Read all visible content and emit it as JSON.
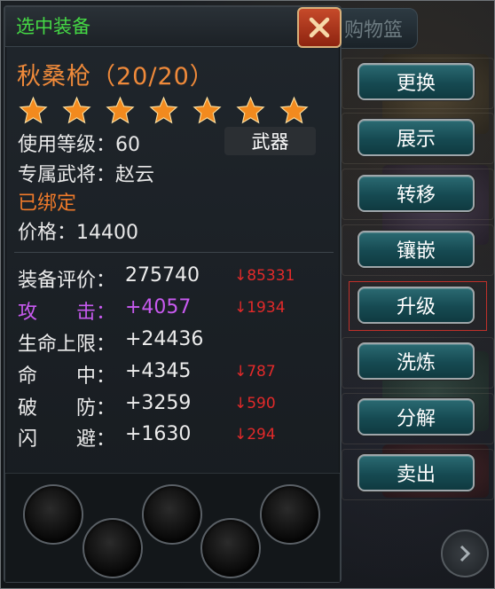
{
  "panel": {
    "title": "选中装备",
    "item_name": "秋桑枪（20/20）",
    "star_count": 7,
    "star_color": "#f28a1e",
    "level_line": "使用等级：60",
    "type_badge": "武器",
    "exclusive_line": "专属武将：赵云",
    "bound_text": "已绑定",
    "price_line": "价格：14400"
  },
  "stats": [
    {
      "label": "装备评价：",
      "value": "275740",
      "diff": "↓85331",
      "highlight": false
    },
    {
      "label": "攻　　击：",
      "value": "+4057",
      "diff": "↓1934",
      "highlight": true
    },
    {
      "label": "生命上限：",
      "value": "+24436",
      "diff": "",
      "highlight": false
    },
    {
      "label": "命　　中：",
      "value": "+4345",
      "diff": "↓787",
      "highlight": false
    },
    {
      "label": "破　　防：",
      "value": "+3259",
      "diff": "↓590",
      "highlight": false
    },
    {
      "label": "闪　　避：",
      "value": "+1630",
      "diff": "↓294",
      "highlight": false
    }
  ],
  "sockets_count": 5,
  "background": {
    "basket_tab": "购物篮"
  },
  "actions": [
    "更换",
    "展示",
    "转移",
    "镶嵌",
    "升级",
    "洗炼",
    "分解",
    "卖出"
  ],
  "highlighted_action": "升级",
  "icons": {
    "close": "close-x-icon",
    "star": "star-icon",
    "next": "chevron-right-icon"
  },
  "colors": {
    "title_green": "#45d945",
    "item_orange": "#f08a3a",
    "diff_red": "#e22a2a",
    "attack_purple": "#c85af0",
    "button_teal": "#1d5a62"
  }
}
